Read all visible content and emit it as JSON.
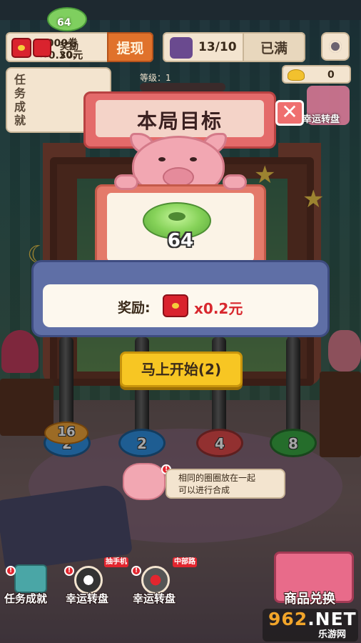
{
  "top_bar": {
    "coupon_amount": "3000券",
    "coupon_value": "≈0.30元",
    "withdraw_label": "提现",
    "energy": "13/10",
    "energy_status": "已满",
    "gold_count": "0"
  },
  "task_panel": {
    "title_lines": [
      "任",
      "务",
      "成",
      "就"
    ],
    "target_number": "64",
    "reward_a": "奖励",
    "reward_b": "x0."
  },
  "level_label": "等级：1",
  "side_wheel_label": "幸运转盘",
  "modal": {
    "title": "本局目标",
    "close_symbol": "✕",
    "target_number": "64",
    "reward_label": "奖励:",
    "reward_value": "x0.2元",
    "start_button": "马上开始(2)"
  },
  "pegs": [
    {
      "value": "2",
      "color": "#2f8fe0"
    },
    {
      "value": "2",
      "color": "#2f8fe0"
    },
    {
      "value": "4",
      "color": "#e04b4b"
    },
    {
      "value": "8",
      "color": "#3aa843"
    }
  ],
  "stacked_ring": {
    "value": "16",
    "color": "#f0a53a"
  },
  "hint": {
    "line1": "相同的圈圈放在一起",
    "line2": "可以进行合成"
  },
  "bottom_nav": [
    {
      "label": "任务成就",
      "icon": "task-book-icon"
    },
    {
      "label": "幸运转盘",
      "icon": "lucky-wheel-icon",
      "tag": "抽手机"
    },
    {
      "label": "幸运转盘",
      "icon": "joystick-icon",
      "tag": "中部路"
    }
  ],
  "shop_label": "商品兑换",
  "watermark": {
    "main_a": "962",
    "main_b": ".NET",
    "sub": "乐游网"
  },
  "colors": {
    "accent_red": "#d9232e",
    "button_yellow": "#f7c623",
    "modal_coral": "#e46a6a",
    "panel_blue": "#5f6fa6"
  }
}
